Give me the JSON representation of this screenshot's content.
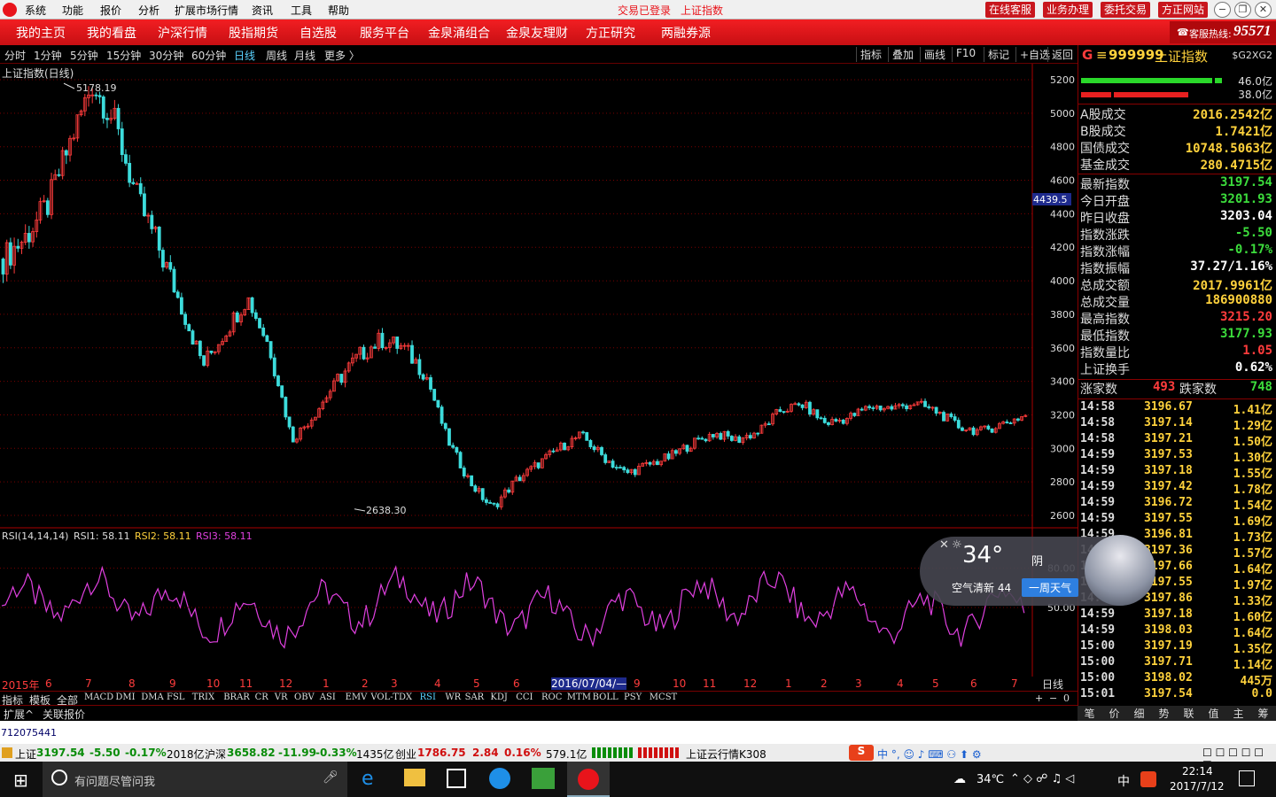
{
  "menubar": {
    "items": [
      "系统",
      "功能",
      "报价",
      "分析",
      "扩展市场行情",
      "资讯",
      "工具",
      "帮助"
    ],
    "status_login": "交易已登录",
    "status_index": "上证指数",
    "buttons": [
      "在线客服",
      "业务办理",
      "委托交易",
      "方正网站"
    ]
  },
  "navbar": {
    "items": [
      "我的主页",
      "我的看盘",
      "沪深行情",
      "股指期货",
      "自选股",
      "服务平台",
      "金泉涌组合",
      "金泉友理财",
      "方正研究",
      "两融券源"
    ],
    "hotline_label": "客服热线:",
    "hotline_number": "95571"
  },
  "periods": {
    "items": [
      "分时",
      "1分钟",
      "5分钟",
      "15分钟",
      "30分钟",
      "60分钟",
      "日线",
      "周线",
      "月线",
      "更多 〉"
    ],
    "active": "日线"
  },
  "toolbar": {
    "items": [
      "指标",
      "叠加",
      "画线",
      "F10",
      "标记",
      "+自选",
      "返回"
    ]
  },
  "chart": {
    "title": "上证指数(日线)",
    "high_label": "5178.19",
    "low_label": "2638.30",
    "cursor_value": "4439.5",
    "y_ticks": [
      "5200",
      "5000",
      "4800",
      "4600",
      "4400",
      "4200",
      "4000",
      "3800",
      "3600",
      "3400",
      "3200",
      "3000",
      "2800",
      "2600"
    ],
    "rsi_title": "RSI(14,14,14)",
    "rsi1": "RSI1: 58.11",
    "rsi2": "RSI2: 58.11",
    "rsi3": "RSI3: 58.11",
    "rsi_ticks": [
      "80.00",
      "50.00"
    ],
    "x_labels": [
      "2015年",
      "6",
      "7",
      "8",
      "9",
      "10",
      "11",
      "12",
      "1",
      "2",
      "3",
      "4",
      "5",
      "6",
      "2016/07/04/—",
      "9",
      "10",
      "11",
      "12",
      "1",
      "2",
      "3",
      "4",
      "5",
      "6",
      "7"
    ],
    "period_label": "日线"
  },
  "indicator_tabs": {
    "items": [
      "指标",
      "模板",
      "全部",
      "MACD",
      "DMI",
      "DMA",
      "FSL",
      "TRIX",
      "BRAR",
      "CR",
      "VR",
      "OBV",
      "ASI",
      "EMV",
      "VOL-TDX",
      "RSI",
      "WR",
      "SAR",
      "KDJ",
      "CCI",
      "ROC",
      "MTM",
      "BOLL",
      "PSY",
      "MCST"
    ],
    "active": "RSI",
    "controls": [
      "+",
      "−",
      "0"
    ]
  },
  "extension": {
    "items": [
      "扩展^",
      "关联报价"
    ]
  },
  "quote": {
    "header_g": "G",
    "code": "999999",
    "name": "上证指数",
    "tag": "$G2XG2",
    "bar_up": "46.0亿",
    "bar_down": "38.0亿",
    "rows": [
      {
        "k": "A股成交",
        "v": "2016.2542亿",
        "c": "#ffd23c"
      },
      {
        "k": "B股成交",
        "v": "1.7421亿",
        "c": "#ffd23c"
      },
      {
        "k": "国债成交",
        "v": "10748.5063亿",
        "c": "#ffd23c"
      },
      {
        "k": "基金成交",
        "v": "280.4715亿",
        "c": "#ffd23c"
      },
      {
        "k": "最新指数",
        "v": "3197.54",
        "c": "#3cdc3c"
      },
      {
        "k": "今日开盘",
        "v": "3201.93",
        "c": "#3cdc3c"
      },
      {
        "k": "昨日收盘",
        "v": "3203.04",
        "c": "#ffffff"
      },
      {
        "k": "指数涨跌",
        "v": "-5.50",
        "c": "#3cdc3c"
      },
      {
        "k": "指数涨幅",
        "v": "-0.17%",
        "c": "#3cdc3c"
      },
      {
        "k": "指数振幅",
        "v": "37.27/1.16%",
        "c": "#ffffff"
      },
      {
        "k": "总成交额",
        "v": "2017.9961亿",
        "c": "#ffd23c"
      },
      {
        "k": "总成交量",
        "v": "186900880",
        "c": "#ffd23c"
      },
      {
        "k": "最高指数",
        "v": "3215.20",
        "c": "#ff3c3c"
      },
      {
        "k": "最低指数",
        "v": "3177.93",
        "c": "#3cdc3c"
      },
      {
        "k": "指数量比",
        "v": "1.05",
        "c": "#ff3c3c"
      },
      {
        "k": "上证换手",
        "v": "0.62%",
        "c": "#ffffff"
      }
    ],
    "breadth": {
      "up_label": "涨家数",
      "up": "493",
      "down_label": "跌家数",
      "down": "748"
    },
    "ticks": [
      {
        "t": "14:58",
        "p": "3196.67",
        "c": "1.41亿"
      },
      {
        "t": "14:58",
        "p": "3197.14",
        "c": "1.29亿"
      },
      {
        "t": "14:58",
        "p": "3197.21",
        "c": "1.50亿"
      },
      {
        "t": "14:59",
        "p": "3197.53",
        "c": "1.30亿"
      },
      {
        "t": "14:59",
        "p": "3197.18",
        "c": "1.55亿"
      },
      {
        "t": "14:59",
        "p": "3197.42",
        "c": "1.78亿"
      },
      {
        "t": "14:59",
        "p": "3196.72",
        "c": "1.54亿"
      },
      {
        "t": "14:59",
        "p": "3197.55",
        "c": "1.69亿"
      },
      {
        "t": "14:59",
        "p": "3196.81",
        "c": "1.73亿"
      },
      {
        "t": "14:59",
        "p": "3197.36",
        "c": "1.57亿"
      },
      {
        "t": "14:59",
        "p": "3197.66",
        "c": "1.64亿"
      },
      {
        "t": "14:59",
        "p": "3197.55",
        "c": "1.97亿"
      },
      {
        "t": "14:59",
        "p": "3197.86",
        "c": "1.33亿"
      },
      {
        "t": "14:59",
        "p": "3197.18",
        "c": "1.60亿"
      },
      {
        "t": "14:59",
        "p": "3198.03",
        "c": "1.64亿"
      },
      {
        "t": "15:00",
        "p": "3197.19",
        "c": "1.35亿"
      },
      {
        "t": "15:00",
        "p": "3197.71",
        "c": "1.14亿"
      },
      {
        "t": "15:00",
        "p": "3198.02",
        "c": "445万"
      },
      {
        "t": "15:01",
        "p": "3197.54",
        "c": "0.0"
      }
    ],
    "tabs": [
      "笔",
      "价",
      "细",
      "势",
      "联",
      "值",
      "主",
      "筹"
    ]
  },
  "account_id": "712075441",
  "ticker": {
    "sh_label": "上证",
    "sh_val": "3197.54",
    "sh_chg": "-5.50",
    "sh_pct": "-0.17%",
    "sh_amt": "2018亿",
    "hs_label": "沪深",
    "hs_val": "3658.82",
    "hs_chg": "-11.99",
    "hs_pct": "-0.33%",
    "hs_amt": "1435亿",
    "cy_label": "创业",
    "cy_val": "1786.75",
    "cy_chg": "2.84",
    "cy_pct": "0.16%",
    "cy_amt": "579.1亿",
    "cloud": "上证云行情K308"
  },
  "weather": {
    "temp": "34°",
    "cond": "阴",
    "air": "空气清新 44",
    "week_btn": "一周天气"
  },
  "taskbar": {
    "search_placeholder": "有问题尽管问我",
    "temp": "34℃",
    "ime": "中",
    "time": "22:14",
    "date": "2017/7/12"
  },
  "chart_data": {
    "type": "candlestick",
    "ylim": [
      2600,
      5200
    ],
    "high": 5178.19,
    "low": 2638.3,
    "rsi_range": [
      0,
      100
    ],
    "close_series": [
      4130,
      4260,
      4450,
      4820,
      5178,
      4950,
      4500,
      4200,
      3850,
      3500,
      3700,
      3900,
      3600,
      3050,
      3200,
      3400,
      3550,
      3650,
      3600,
      3450,
      3050,
      2800,
      2640,
      2800,
      2900,
      3000,
      3080,
      2950,
      2850,
      2900,
      2950,
      3030,
      3090,
      3050,
      3100,
      3230,
      3260,
      3150,
      3180,
      3250,
      3240,
      3270,
      3220,
      3130,
      3100,
      3150,
      3197
    ]
  }
}
